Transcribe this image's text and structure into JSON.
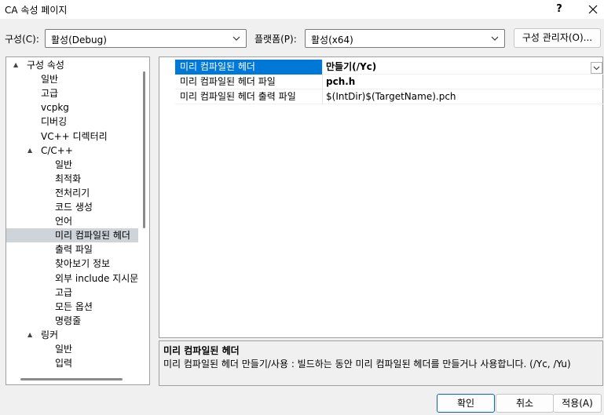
{
  "window": {
    "title": "CA 속성 페이지",
    "help": "?",
    "close_icon": "close-icon"
  },
  "config": {
    "label": "구성(C):",
    "value": "활성(Debug)"
  },
  "platform": {
    "label": "플랫폼(P):",
    "value": "활성(x64)"
  },
  "config_manager_label": "구성 관리자(O)...",
  "tree": [
    {
      "label": "구성 속성",
      "level": 0,
      "toggle": "▲"
    },
    {
      "label": "일반",
      "level": 1
    },
    {
      "label": "고급",
      "level": 1
    },
    {
      "label": "vcpkg",
      "level": 1
    },
    {
      "label": "디버깅",
      "level": 1
    },
    {
      "label": "VC++ 디렉터리",
      "level": 1
    },
    {
      "label": "C/C++",
      "level": 1,
      "toggle": "▲"
    },
    {
      "label": "일반",
      "level": 2
    },
    {
      "label": "최적화",
      "level": 2
    },
    {
      "label": "전처리기",
      "level": 2
    },
    {
      "label": "코드 생성",
      "level": 2
    },
    {
      "label": "언어",
      "level": 2
    },
    {
      "label": "미리 컴파일된 헤더",
      "level": 2,
      "selected": true
    },
    {
      "label": "출력 파일",
      "level": 2
    },
    {
      "label": "찾아보기 정보",
      "level": 2
    },
    {
      "label": "외부 include 지시문",
      "level": 2
    },
    {
      "label": "고급",
      "level": 2
    },
    {
      "label": "모든 옵션",
      "level": 2
    },
    {
      "label": "명령줄",
      "level": 2
    },
    {
      "label": "링커",
      "level": 1,
      "toggle": "▲"
    },
    {
      "label": "일반",
      "level": 2
    },
    {
      "label": "입력",
      "level": 2
    }
  ],
  "properties": [
    {
      "name": "미리 컴파일된 헤더",
      "value": "만들기(/Yc)",
      "bold": true,
      "selected": true
    },
    {
      "name": "미리 컴파일된 헤더 파일",
      "value": "pch.h",
      "bold": true
    },
    {
      "name": "미리 컴파일된 헤더 출력 파일",
      "value": "$(IntDir)$(TargetName).pch",
      "bold": false
    }
  ],
  "description": {
    "title": "미리 컴파일된 헤더",
    "text": "미리 컴파일된 헤더 만들기/사용 : 빌드하는 동안 미리 컴파일된 헤더를 만들거나 사용합니다.      (/Yc, /Yu)"
  },
  "buttons": {
    "ok": "확인",
    "cancel": "취소",
    "apply": "적용(A)"
  }
}
